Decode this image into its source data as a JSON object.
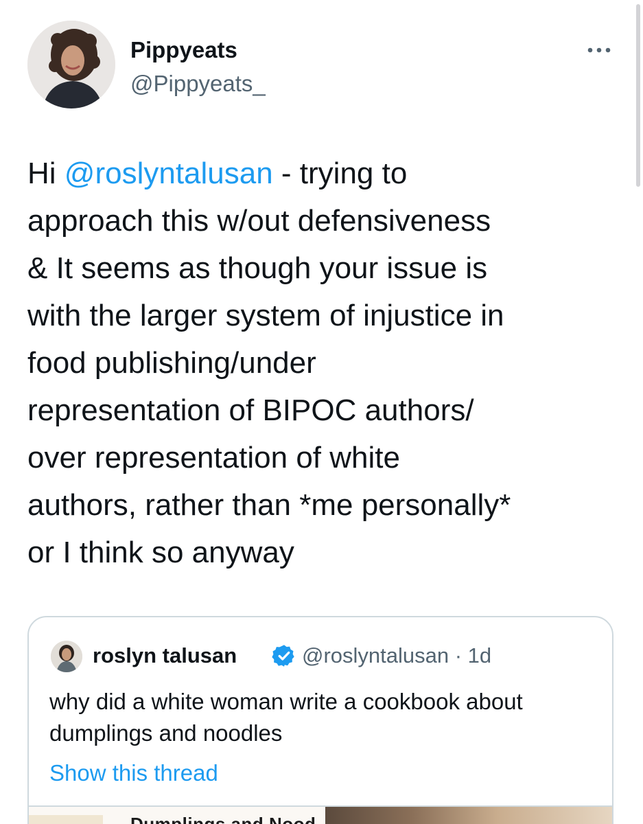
{
  "author": {
    "display_name": "Pippyeats",
    "handle": "@Pippyeats_"
  },
  "more_icon": "more-horizontal-icon",
  "tweet": {
    "lines": [
      {
        "mention": "@roslyntalusan",
        "prefix": "Hi ",
        "suffix": " - trying to"
      },
      "approach this w/out defensiveness",
      "& It seems as though your issue is",
      "with the larger system of injustice in",
      "food publishing/under",
      "representation of BIPOC authors/",
      "over representation of white",
      "authors, rather than *me personally*",
      "or I think so anyway"
    ]
  },
  "quoted_tweet": {
    "display_name": "roslyn talusan",
    "verified_icon": "verified-badge-icon",
    "handle_time": "@roslyntalusan · 1d",
    "text_lines": [
      "why did a white woman write a cookbook about",
      "dumplings and noodles"
    ],
    "show_thread": "Show this thread",
    "media_book_title": "Dumplings and Nood"
  },
  "colors": {
    "link": "#1d9bf0",
    "secondary_text": "#536471",
    "border": "#cfd9de",
    "text": "#0f1419"
  }
}
